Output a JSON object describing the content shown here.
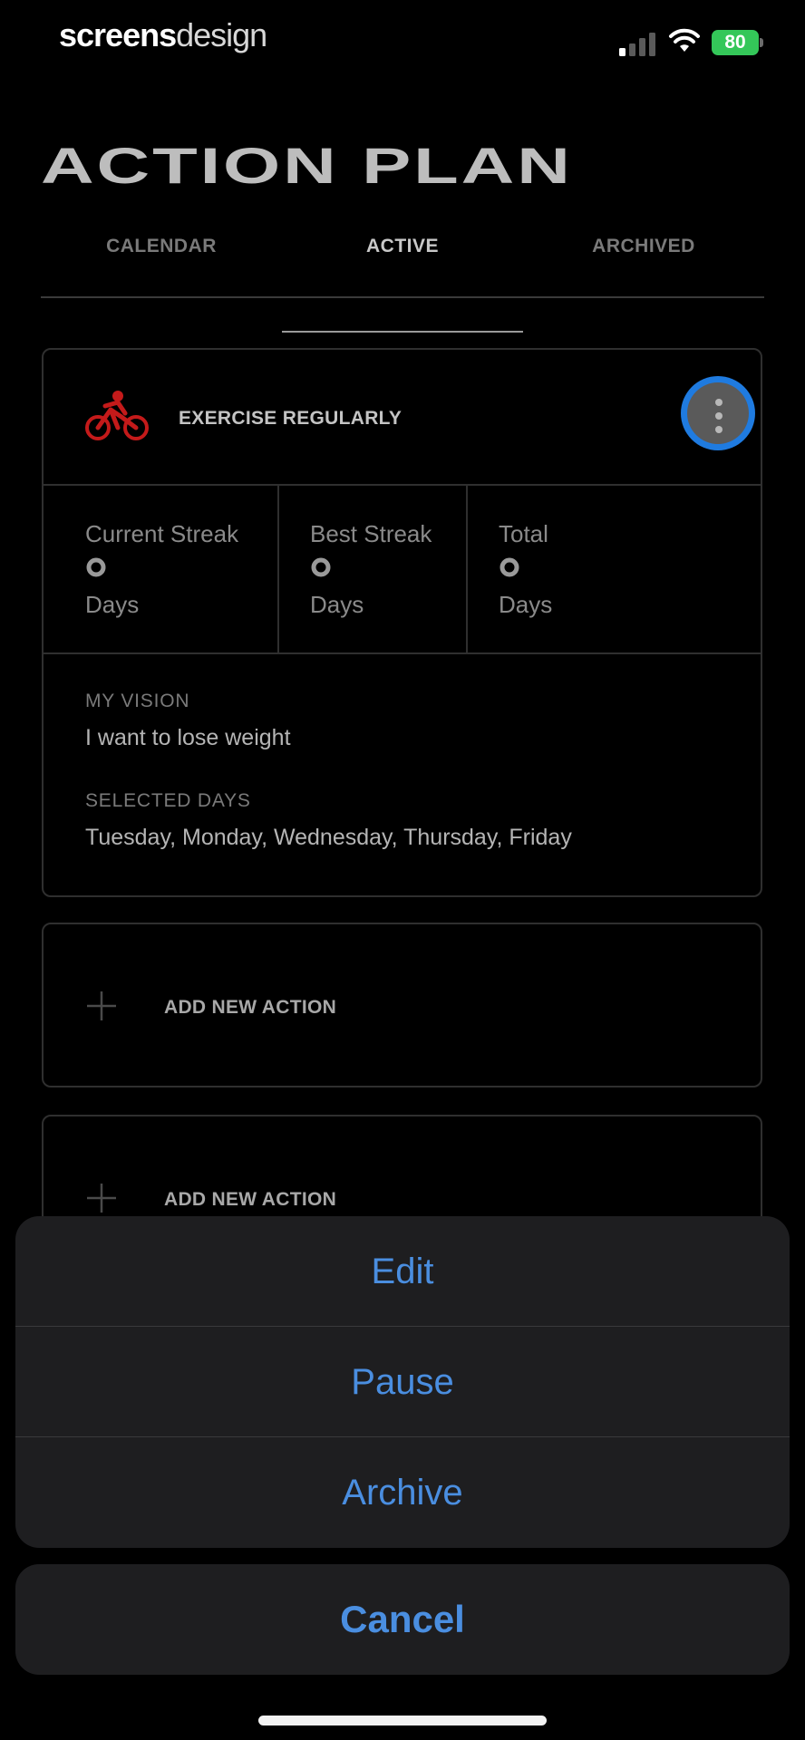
{
  "status_bar": {
    "brand_part1": "screens",
    "brand_part2": "design",
    "battery": "80"
  },
  "page": {
    "title": "ACTION PLAN"
  },
  "tabs": [
    {
      "label": "CALENDAR"
    },
    {
      "label": "ACTIVE"
    },
    {
      "label": "ARCHIVED"
    }
  ],
  "habit": {
    "name": "EXERCISE REGULARLY",
    "icon": "bike-icon",
    "icon_color": "#c41a1a",
    "stats": [
      {
        "label": "Current Streak",
        "unit": "Days"
      },
      {
        "label": "Best Streak",
        "unit": "Days"
      },
      {
        "label": "Total",
        "unit": "Days"
      }
    ],
    "vision_label": "MY VISION",
    "vision": "I want to lose weight",
    "days_label": "SELECTED DAYS",
    "days": "Tuesday, Monday, Wednesday, Thursday, Friday"
  },
  "add_cards": [
    {
      "label": "ADD NEW ACTION"
    },
    {
      "label": "ADD NEW ACTION"
    }
  ],
  "action_sheet": {
    "items": [
      {
        "label": "Edit"
      },
      {
        "label": "Pause"
      },
      {
        "label": "Archive"
      }
    ],
    "cancel": "Cancel",
    "accent": "#4a8ee0"
  },
  "colors": {
    "background": "#000000",
    "highlight_ring": "#1f7be0",
    "battery": "#34c759"
  }
}
